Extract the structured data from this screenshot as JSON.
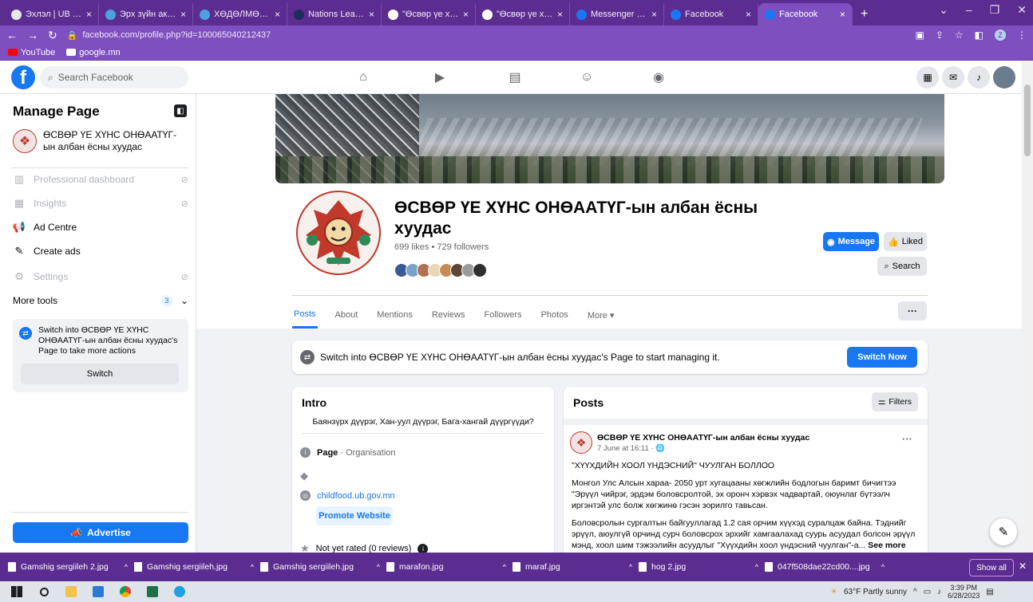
{
  "browser": {
    "tabs": [
      {
        "label": "Эхлэл | UB ERP",
        "fav_color": "#e8e8e8",
        "active": false
      },
      {
        "label": "Эрх зүйн актууд",
        "fav_color": "#4aa3df",
        "active": false
      },
      {
        "label": "ХӨДӨЛМӨРИЙН ТУХ",
        "fav_color": "#4aa3df",
        "active": false
      },
      {
        "label": "Nations League Wome",
        "fav_color": "#1f2d5c",
        "active": false
      },
      {
        "label": "\"Өсвөр үе хүнс\" ОНӨ",
        "fav_color": "#ffffff",
        "active": false
      },
      {
        "label": "\"Өсвөр үе хүнс\" ОНӨ",
        "fav_color": "#ffffff",
        "active": false
      },
      {
        "label": "Messenger | Facebook",
        "fav_color": "#1877f2",
        "active": false
      },
      {
        "label": "Facebook",
        "fav_color": "#1877f2",
        "active": false
      },
      {
        "label": "Facebook",
        "fav_color": "#1877f2",
        "active": true
      }
    ],
    "new_tab": "+",
    "url": "facebook.com/profile.php?id=100065040212437",
    "bookmarks": [
      {
        "label": "YouTube",
        "color": "#ff0000"
      },
      {
        "label": "google.mn",
        "color": "#ffffff"
      }
    ],
    "profile_badge": "Z"
  },
  "fb_header": {
    "logo": "f",
    "search_placeholder": "Search Facebook",
    "nav_icons": [
      "home-icon",
      "video-icon",
      "marketplace-icon",
      "groups-icon",
      "gaming-icon"
    ]
  },
  "sidebar": {
    "title": "Manage Page",
    "page_name": "ӨСВӨР ҮЕ ХҮНС ОНӨААТҮГ-ын албан ёсны хуудас",
    "items": [
      {
        "label": "Professional dashboard",
        "disabled": true,
        "icon": "▥"
      },
      {
        "label": "Insights",
        "disabled": true,
        "icon": "▦"
      },
      {
        "label": "Ad Centre",
        "disabled": false,
        "icon": "📢"
      },
      {
        "label": "Create ads",
        "disabled": false,
        "icon": "✎"
      },
      {
        "label": "Settings",
        "disabled": true,
        "icon": "⚙"
      }
    ],
    "lock_symbol": "⊘",
    "more_tools": "More tools",
    "more_tools_count": "3",
    "switch_text": "Switch into ӨСВӨР ҮЕ ХҮНС ОНӨААТҮГ-ын албан ёсны хуудас's Page to take more actions",
    "switch_button": "Switch",
    "advertise_button": "Advertise"
  },
  "profile": {
    "title": "ӨСВӨР ҮЕ ХҮНС ОНӨААТҮГ-ын албан ёсны хуудас",
    "stats": "699 likes • 729 followers",
    "message_button": "Message",
    "liked_button": "Liked",
    "search_button": "Search",
    "follower_colors": [
      "#3b5998",
      "#7aa3c7",
      "#b46f4e",
      "#e8d7b4",
      "#c98a56",
      "#5e4634",
      "#9a9a9a",
      "#2f2f2f"
    ],
    "tabs": [
      "Posts",
      "About",
      "Mentions",
      "Reviews",
      "Followers",
      "Photos",
      "More ▾"
    ],
    "active_tab": "Posts",
    "tab_menu": "···"
  },
  "switch_banner": {
    "text": "Switch into ӨСВӨР ҮЕ ХҮНС ОНӨААТҮГ-ын албан ёсны хуудас's Page to start managing it.",
    "button": "Switch Now"
  },
  "intro": {
    "title": "Intro",
    "bio": "Баянзүрх дүүрэг, Хан-уул дүүрэг, Бага-хангай дүүргүүди?",
    "category_label": "Page",
    "category_value": " · Organisation",
    "website": "childfood.ub.gov.mn",
    "promote_button": "Promote Website",
    "rating": "Not yet rated (0 reviews)"
  },
  "posts": {
    "title": "Posts",
    "filters_button": "Filters",
    "author": "ӨСВӨР ҮЕ ХҮНС ОНӨААТҮГ-ын албан ёсны хуудас",
    "time": "7 June at 16:11 · 🌐",
    "headline": "\"ХҮҮХДИЙН ХООЛ ҮНДЭСНИЙ\" ЧУУЛГАН БОЛЛОО",
    "para1": "Монгол Улс Алсын хараа- 2050 урт хугацааны хөгжлийн бодлогын баримт бичигтээ \"Эрүүл чийрэг, эрдэм боловсролтой, эх оронч хэрвэх чадвартай, оюунлаг бүтээлч иргэнтэй улс болж хөгжинө гэсэн зорилго тавьсан.",
    "para2": "Боловсролын сургалтын байгууллагад 1.2 сая орчим хүүхэд суралцаж байна. Тэднийг эрүүл, аюулгүй орчинд сурч боловсрох эрхийг хамгаалахад суурь асуудал болсон эрүүл мэнд, хоол шим тэжээлийн асуудлыг \"Хүүхдийн хоол үндэсний чуулган\"-а...",
    "see_more": "See more"
  },
  "downloads": {
    "files": [
      "Gamshig sergiileh 2.jpg",
      "Gamshig sergiileh.jpg",
      "Gamshig sergiileh.jpg",
      "marafon.jpg",
      "maraf.jpg",
      "hog 2.jpg",
      "047f508dae22cd00....jpg"
    ],
    "show_all": "Show all"
  },
  "taskbar": {
    "weather": "63°F  Partly sunny",
    "time": "3:39 PM",
    "date": "6/28/2023"
  }
}
